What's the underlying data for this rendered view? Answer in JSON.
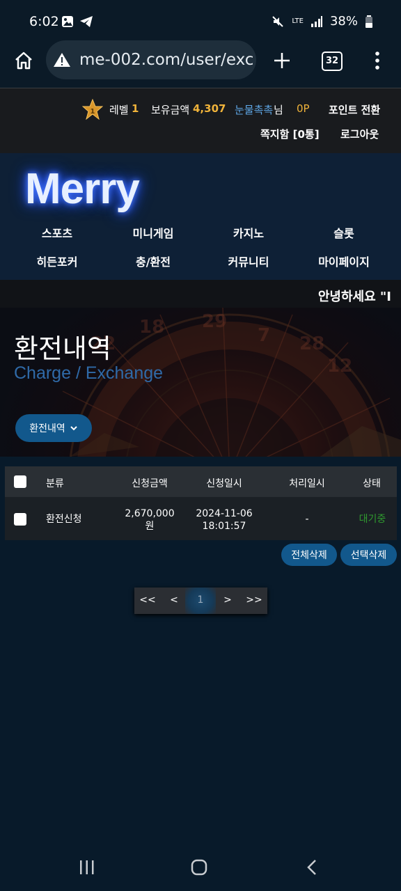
{
  "status_bar": {
    "time": "6:02",
    "signal": "LTE",
    "battery": "38%"
  },
  "browser": {
    "url": "me-002.com/user/exc",
    "tab_count": "32"
  },
  "user_bar": {
    "level_label": "레벨",
    "level_value": "1",
    "balance_label": "보유금액",
    "balance_value": "4,307",
    "username": "눈물촉촉",
    "username_suffix": "님",
    "points": "0P",
    "point_convert": "포인트 전환",
    "messages": "쪽지함 [0통]",
    "logout": "로그아웃"
  },
  "logo": "Merry",
  "nav": {
    "row1": [
      "스포츠",
      "미니게임",
      "카지노",
      "슬롯"
    ],
    "row2": [
      "히든포커",
      "충/환전",
      "커뮤니티",
      "마이페이지"
    ]
  },
  "marquee": "안녕하세요 \"I",
  "hero": {
    "title": "환전내역",
    "subtitle": "Charge / Exchange",
    "dropdown_label": "환전내역"
  },
  "table": {
    "headers": [
      "분류",
      "신청금액",
      "신청일시",
      "처리일시",
      "상태"
    ],
    "rows": [
      {
        "type": "환전신청",
        "amount_line1": "2,670,000",
        "amount_line2": "원",
        "date_line1": "2024-11-06",
        "date_line2": "18:01:57",
        "processed": "-",
        "status": "대기중"
      }
    ]
  },
  "actions": {
    "delete_all": "전체삭제",
    "delete_selected": "선택삭제"
  },
  "pagination": {
    "first": "<<",
    "prev": "<",
    "current": "1",
    "next": ">",
    "last": ">>"
  },
  "colors": {
    "accent": "#12588c",
    "gold": "#f0b33a",
    "status_pending": "#2f9a2f",
    "subtitle_blue": "#2f6aa8"
  }
}
